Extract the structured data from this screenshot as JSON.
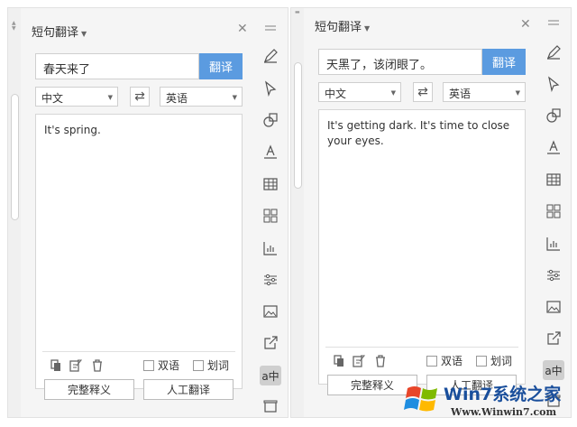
{
  "left": {
    "title": "短句翻译",
    "source_text": "春天来了",
    "translate_button": "翻译",
    "source_lang": "中文",
    "target_lang": "英语",
    "result": "It's spring.",
    "bilingual_label": "双语",
    "select_word_label": "划词",
    "full_definition_button": "完整释义",
    "human_translate_button": "人工翻译"
  },
  "right": {
    "title": "短句翻译",
    "source_text": "天黑了，该闭眼了。",
    "translate_button": "翻译",
    "source_lang": "中文",
    "target_lang": "英语",
    "result": "It's getting dark. It's time to close your eyes.",
    "bilingual_label": "双语",
    "select_word_label": "划词",
    "full_definition_button": "完整释义",
    "human_translate_button": "人工翻译"
  },
  "watermark": {
    "brand": "Win7系统之家",
    "url": "Www.Winwin7.com"
  },
  "toolbar_icons": [
    "menu-icon",
    "pen-icon",
    "cursor-icon",
    "shapes-icon",
    "text-fill-icon",
    "table-icon",
    "apps-icon",
    "chart-icon",
    "sliders-icon",
    "image-icon",
    "share-icon",
    "translate-icon",
    "box-icon"
  ],
  "colors": {
    "accent": "#5b9be0",
    "panel": "#f5f5f5"
  }
}
